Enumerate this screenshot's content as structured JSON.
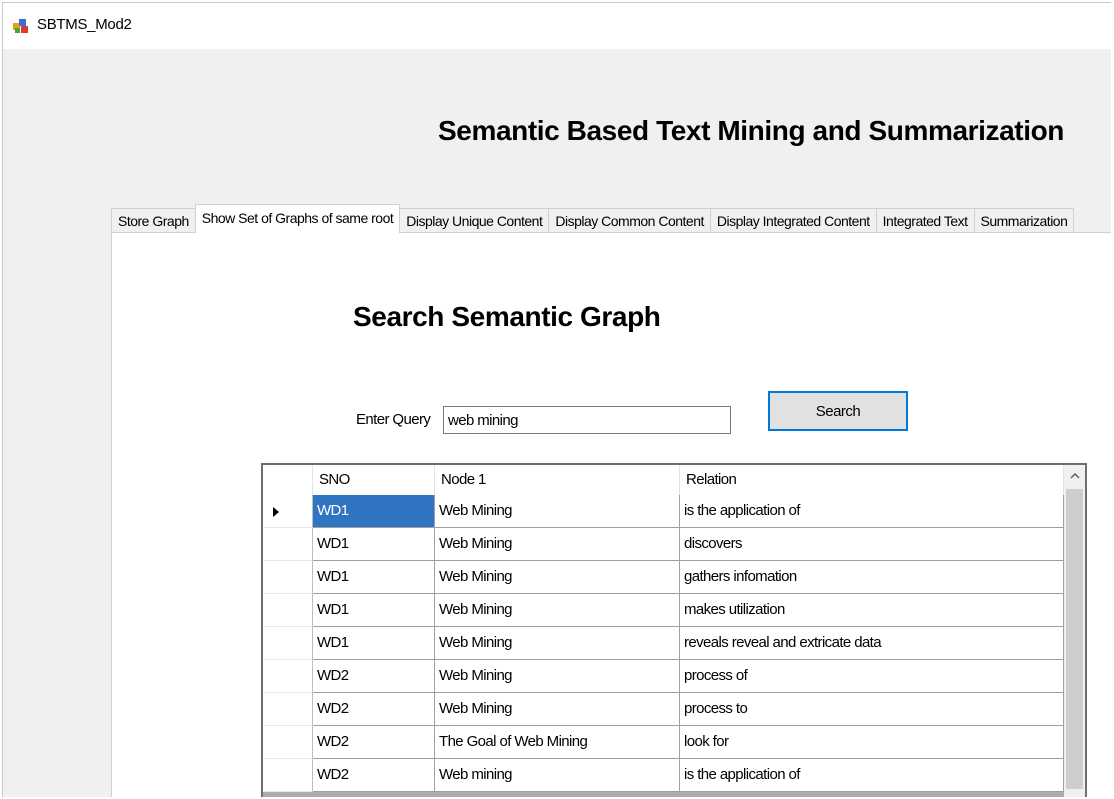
{
  "window": {
    "title": "SBTMS_Mod2"
  },
  "main_heading": "Semantic Based Text Mining and Summarization",
  "tabs": [
    {
      "label": "Store Graph",
      "active": false
    },
    {
      "label": "Show Set of Graphs of same root",
      "active": true
    },
    {
      "label": "Display Unique Content",
      "active": false
    },
    {
      "label": "Display Common Content",
      "active": false
    },
    {
      "label": "Display Integrated Content",
      "active": false
    },
    {
      "label": "Integrated Text",
      "active": false
    },
    {
      "label": "Summarization",
      "active": false
    }
  ],
  "panel": {
    "heading": "Search Semantic Graph",
    "query_label": "Enter Query",
    "query_value": "web mining",
    "search_button": "Search"
  },
  "grid": {
    "columns": [
      "SNO",
      "Node 1",
      "Relation"
    ],
    "selected_row": 0,
    "rows": [
      {
        "sno": "WD1",
        "node1": "Web Mining",
        "relation": "is the application of"
      },
      {
        "sno": "WD1",
        "node1": "Web Mining",
        "relation": "discovers"
      },
      {
        "sno": "WD1",
        "node1": "Web Mining",
        "relation": "gathers infomation"
      },
      {
        "sno": "WD1",
        "node1": "Web Mining",
        "relation": "makes utilization"
      },
      {
        "sno": "WD1",
        "node1": "Web Mining",
        "relation": "reveals reveal and extricate data"
      },
      {
        "sno": "WD2",
        "node1": "Web Mining",
        "relation": "process of"
      },
      {
        "sno": "WD2",
        "node1": "Web Mining",
        "relation": "process to"
      },
      {
        "sno": "WD2",
        "node1": "The Goal of Web Mining",
        "relation": "look for"
      },
      {
        "sno": "WD2",
        "node1": "Web mining",
        "relation": "is the application of"
      }
    ]
  },
  "icons": {
    "app": "app-icon",
    "row_indicator": "current-row-arrow-icon",
    "scroll_up": "scroll-up-arrow-icon"
  },
  "colors": {
    "selection": "#2f75c2",
    "focus_border": "#0078d7"
  }
}
